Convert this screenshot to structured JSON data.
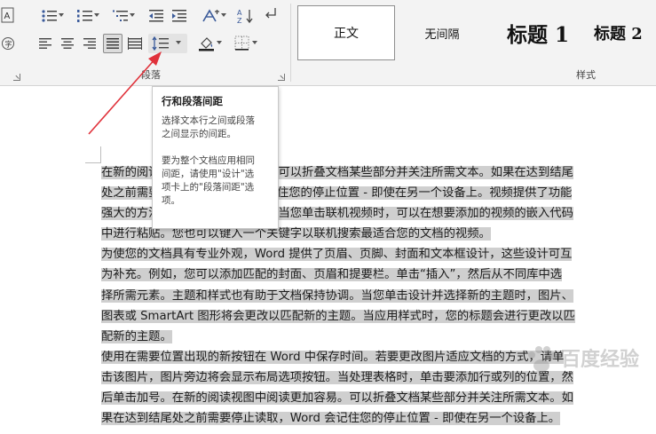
{
  "ribbon": {
    "paragraph_group_label": "段落",
    "styles_group_label": "样式",
    "styles": [
      {
        "label": "正文"
      },
      {
        "label": "无间隔"
      },
      {
        "label": "标题 1"
      },
      {
        "label": "标题 2"
      }
    ],
    "icons": {
      "bullets": "bullets-icon",
      "numbering": "numbering-icon",
      "multilevel": "multilevel-list-icon",
      "decrease_indent": "decrease-indent-icon",
      "increase_indent": "increase-indent-icon",
      "chinese_layout": "chinese-layout-icon",
      "sort": "sort-icon",
      "show_marks": "paragraph-mark-icon",
      "align_left": "align-left-icon",
      "align_center": "align-center-icon",
      "align_right": "align-right-icon",
      "justify": "justify-icon",
      "distributed": "distributed-icon",
      "line_spacing": "line-spacing-icon",
      "shading": "shading-icon",
      "borders": "borders-icon"
    }
  },
  "tooltip": {
    "title": "行和段落间距",
    "description": "选择文本行之间或段落\n之间显示的间距。",
    "hint": "要为整个文档应用相同\n间距，请使用\"设计\"选\n项卡上的\"段落间距\"选\n项。"
  },
  "document": {
    "lines": [
      "在新的阅读视图中阅读更加容易。可以折叠文档某些部分并关注所需文本。如果在达到结尾",
      "处之前需要停止读取，Word 会记住您的停止位置 - 即使在另一个设备上。视频提供了功能",
      "强大的方法帮助您证明您的观点。当您单击联机视频时，可以在想要添加的视频的嵌入代码",
      "中进行粘贴。您也可以键入一个关键字以联机搜索最适合您的文档的视频。",
      "为使您的文档具有专业外观，Word 提供了页眉、页脚、封面和文本框设计，这些设计可互",
      "为补充。例如，您可以添加匹配的封面、页眉和提要栏。单击“插入”，然后从不同库中选",
      "择所需元素。主题和样式也有助于文档保持协调。当您单击设计并选择新的主题时，图片、",
      "图表或 SmartArt 图形将会更改以匹配新的主题。当应用样式时，您的标题会进行更改以匹",
      "配新的主题。",
      "使用在需要位置出现的新按钮在 Word 中保存时间。若要更改图片适应文档的方式，请单",
      "击该图片，图片旁边将会显示布局选项按钮。当处理表格时，单击要添加行或列的位置，然",
      "后单击加号。在新的阅读视图中阅读更加容易。可以折叠文档某些部分并关注所需文本。如",
      "果在达到结尾处之前需要停止读取，Word 会记住您的停止位置 - 即使在另一个设备上。"
    ]
  },
  "colors": {
    "ribbon_bg": "#f3f3f3",
    "selection": "#cfcfcf",
    "annotation_arrow": "#e0313a",
    "underline": "#3c78d8"
  },
  "watermark": {
    "text": "百度经验"
  }
}
